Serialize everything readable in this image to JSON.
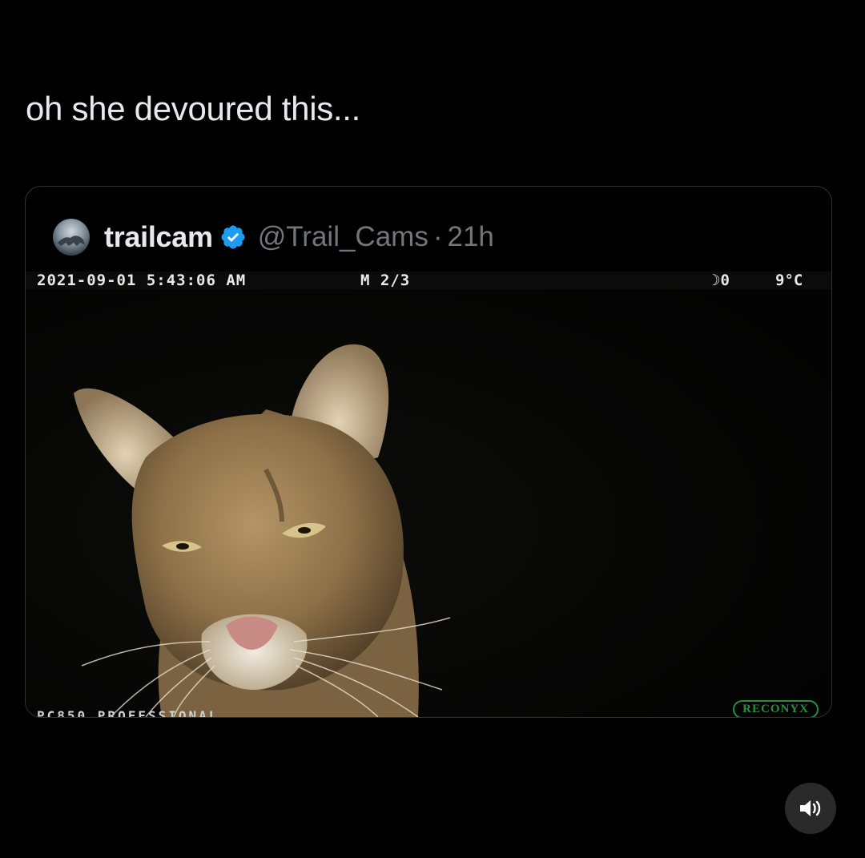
{
  "post": {
    "caption": "oh she devoured this..."
  },
  "quoted_tweet": {
    "display_name": "trailcam",
    "verified": true,
    "handle": "@Trail_Cams",
    "separator": "·",
    "time": "21h",
    "photo": {
      "description_icon": "mountain-lion-photo",
      "osd": {
        "datetime": "2021-09-01 5:43:06 AM",
        "camera_info": "M 2/3",
        "moon_phase": "☽0",
        "temperature": "9°C",
        "footer": "PC850 PROFESSIONAL"
      },
      "brand": "RECONYX"
    }
  },
  "controls": {
    "audio_icon": "speaker-icon"
  },
  "colors": {
    "background": "#000000",
    "text_primary": "#e7e9ea",
    "text_secondary": "#71767b",
    "verified_blue": "#1d9bf0",
    "border": "#2f3336",
    "brand_green": "#2c8a3c"
  }
}
